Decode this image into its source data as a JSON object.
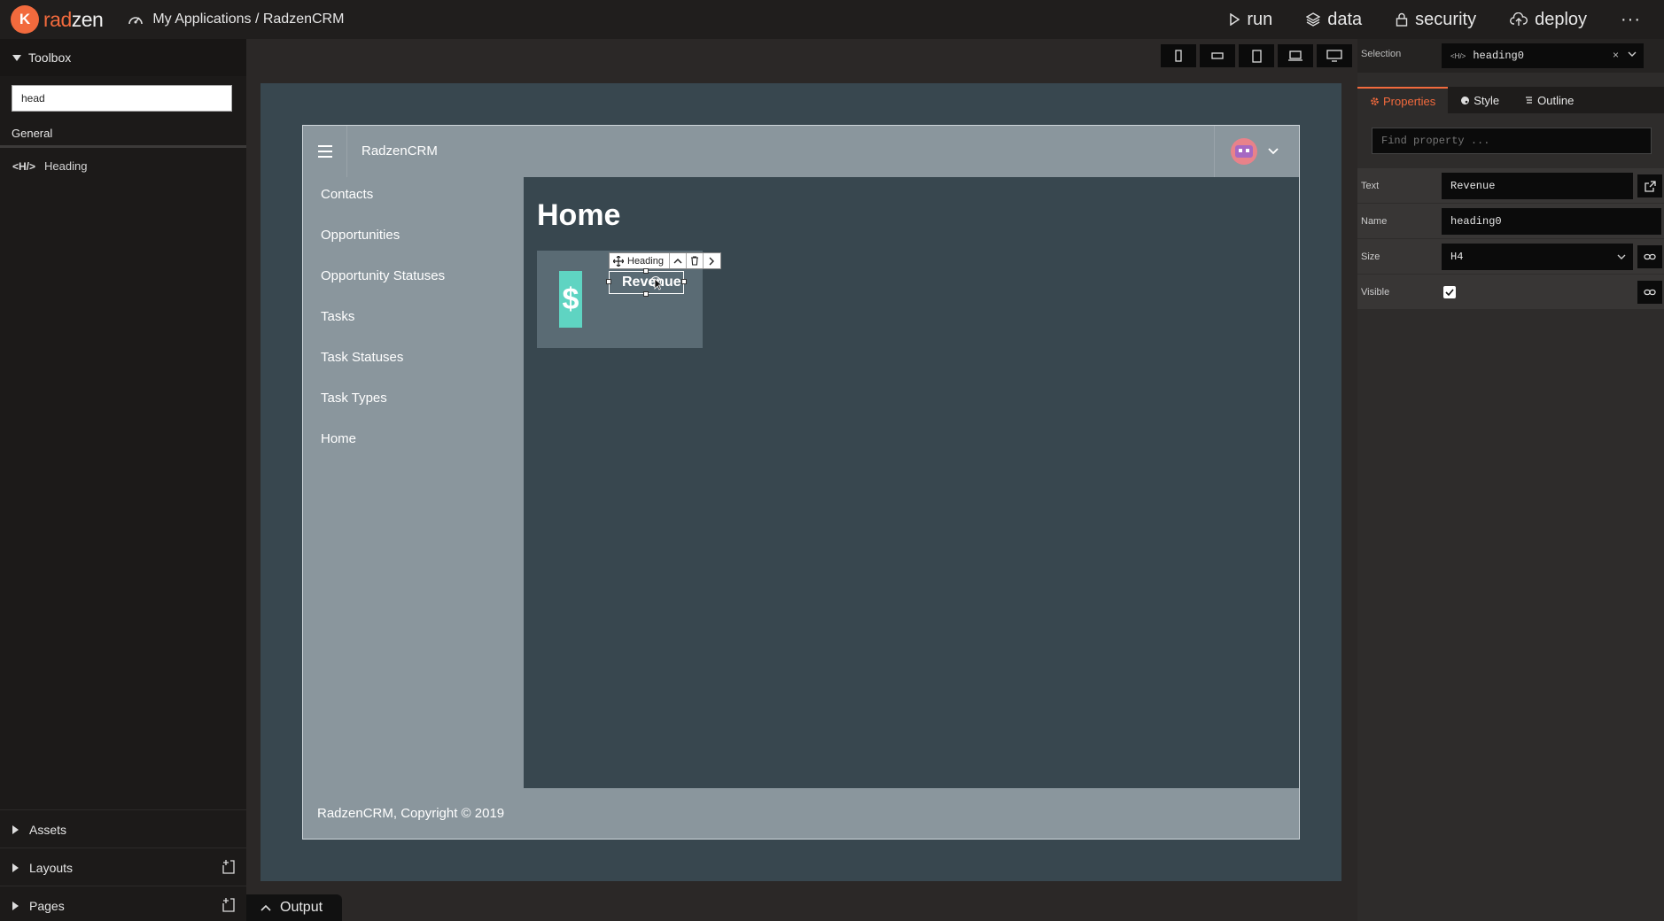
{
  "topbar": {
    "logo_text_rad": "rad",
    "logo_text_zen": "zen",
    "breadcrumb": "My Applications / RadzenCRM",
    "actions": {
      "run": "run",
      "data": "data",
      "security": "security",
      "deploy": "deploy",
      "more": "···"
    }
  },
  "toolbox": {
    "title": "Toolbox",
    "search_value": "head",
    "section": "General",
    "item_icon": "<H/>",
    "item_label": "Heading",
    "bottom": {
      "assets": "Assets",
      "layouts": "Layouts",
      "pages": "Pages"
    }
  },
  "app": {
    "title": "RadzenCRM",
    "nav": [
      "Contacts",
      "Opportunities",
      "Opportunity Statuses",
      "Tasks",
      "Task Statuses",
      "Task Types",
      "Home"
    ],
    "page_title": "Home",
    "card_icon": "$",
    "heading_text": "Revenue",
    "selection_toolbar_label": "Heading",
    "footer": "RadzenCRM, Copyright © 2019"
  },
  "output": {
    "label": "Output"
  },
  "right_panel": {
    "selection_label": "Selection",
    "selection_icon": "<H/>",
    "selection_value": "heading0",
    "selection_clear": "×",
    "tabs": [
      "Properties",
      "Style",
      "Outline"
    ],
    "find_placeholder": "Find property ...",
    "props": {
      "text_label": "Text",
      "text_value": "Revenue",
      "name_label": "Name",
      "name_value": "heading0",
      "size_label": "Size",
      "size_value": "H4",
      "visible_label": "Visible"
    }
  },
  "colors": {
    "accent": "#f26a3d",
    "teal": "#5fd4c2",
    "app_chrome": "#8a969d",
    "app_body": "#38474f"
  }
}
